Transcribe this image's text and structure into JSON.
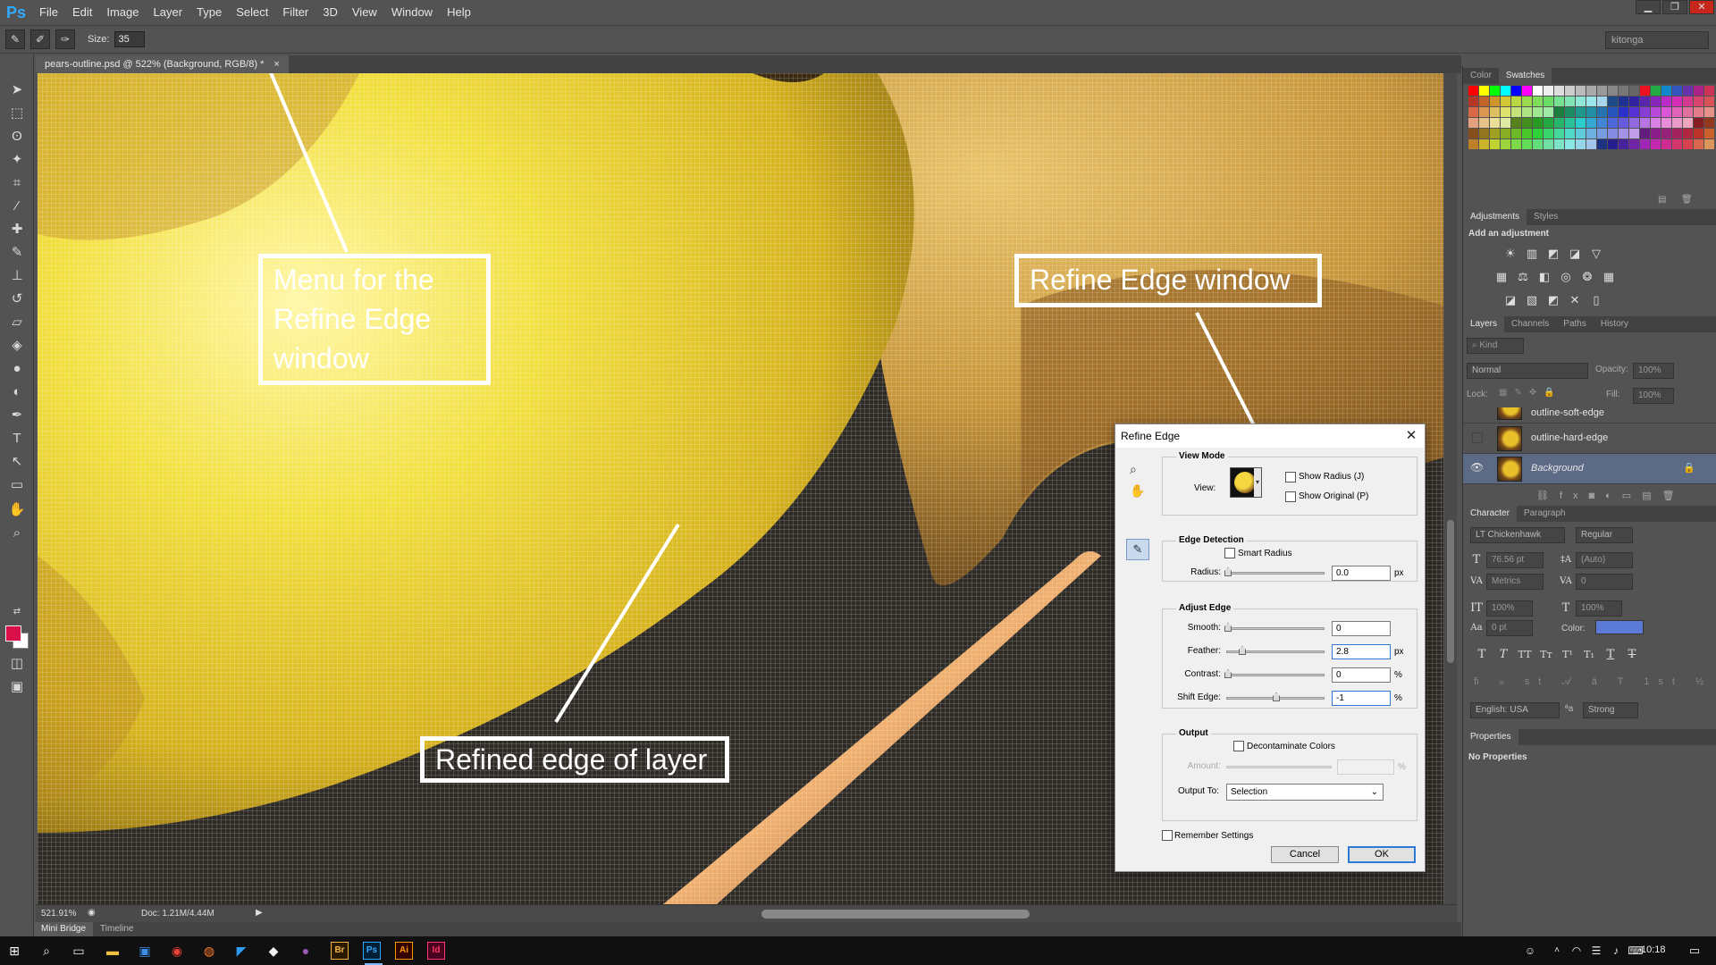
{
  "menu": [
    "File",
    "Edit",
    "Image",
    "Layer",
    "Type",
    "Select",
    "Filter",
    "3D",
    "View",
    "Window",
    "Help"
  ],
  "app_logo": "Ps",
  "options": {
    "size_label": "Size:",
    "size_value": "35",
    "workspace": "kitonga"
  },
  "document": {
    "tab_title": "pears-outline.psd @ 522% (Background, RGB/8) *",
    "close": "×"
  },
  "annotations": {
    "menu_note": [
      "Menu for the",
      "Refine Edge",
      "window"
    ],
    "window_note": "Refine Edge window",
    "edge_note": "Refined edge of layer"
  },
  "status": {
    "zoom": "521.91%",
    "doc": "Doc: 1.21M/4.44M"
  },
  "bottom_tabs": [
    "Mini Bridge",
    "Timeline"
  ],
  "colors": {
    "foreground": "#d8114a",
    "background": "#ffffff",
    "accent": "#2f7ad6"
  },
  "panels": {
    "color_tabs": [
      "Color",
      "Swatches"
    ],
    "adjust_tabs": [
      "Adjustments",
      "Styles"
    ],
    "adjust_heading": "Add an adjustment",
    "layer_tabs": [
      "Layers",
      "Channels",
      "Paths",
      "History"
    ],
    "layer_filter": "Kind",
    "blend_mode": "Normal",
    "opacity_label": "Opacity:",
    "opacity_value": "100%",
    "lock_label": "Lock:",
    "fill_label": "Fill:",
    "fill_value": "100%",
    "layers": [
      {
        "name": "outline-soft-edge",
        "visible": false
      },
      {
        "name": "outline-hard-edge",
        "visible": false
      },
      {
        "name": "Background",
        "visible": true,
        "selected": true
      }
    ],
    "char_tabs": [
      "Character",
      "Paragraph"
    ],
    "font_family": "LT Chickenhawk",
    "font_style": "Regular",
    "font_size": "76.56 pt",
    "leading": "(Auto)",
    "kerning": "Metrics",
    "tracking": "0",
    "vscale": "100%",
    "hscale": "100%",
    "baseline": "0 pt",
    "color_label": "Color:",
    "language": "English: USA",
    "antialias": "Strong",
    "properties_tab": "Properties",
    "properties_text": "No Properties"
  },
  "dialog": {
    "title": "Refine Edge",
    "view_mode": {
      "title": "View Mode",
      "view_label": "View:",
      "show_radius": "Show Radius (J)",
      "show_original": "Show Original (P)"
    },
    "edge_detection": {
      "title": "Edge Detection",
      "smart_radius": "Smart Radius",
      "radius_label": "Radius:",
      "radius_value": "0.0",
      "radius_unit": "px"
    },
    "adjust_edge": {
      "title": "Adjust Edge",
      "smooth_label": "Smooth:",
      "smooth_value": "0",
      "feather_label": "Feather:",
      "feather_value": "2.8",
      "feather_unit": "px",
      "contrast_label": "Contrast:",
      "contrast_value": "0",
      "contrast_unit": "%",
      "shift_label": "Shift Edge:",
      "shift_value": "-1",
      "shift_unit": "%"
    },
    "output": {
      "title": "Output",
      "decontaminate": "Decontaminate Colors",
      "amount_label": "Amount:",
      "amount_unit": "%",
      "output_to_label": "Output To:",
      "output_to_value": "Selection"
    },
    "remember": "Remember Settings",
    "cancel": "Cancel",
    "ok": "OK"
  },
  "taskbar": {
    "clock": "10:18"
  }
}
